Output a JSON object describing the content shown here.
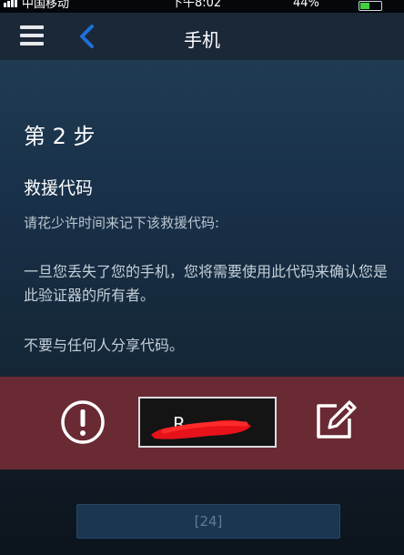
{
  "status_bar": {
    "carrier": "中国移动",
    "time": "下午8:02",
    "battery": "44%"
  },
  "nav": {
    "title": "手机",
    "menu_icon": "hamburger-menu-icon",
    "back_icon": "chevron-left-icon"
  },
  "content": {
    "step_title": "第 2 步",
    "heading": "救援代码",
    "instruction": "请花少许时间来记下该救援代码:",
    "warning_text": "一旦您丢失了您的手机，您将需要使用此代码来确认您是此验证器的所有者。",
    "share_notice": "不要与任何人分享代码。"
  },
  "code_panel": {
    "warning_icon": "exclamation-circle-icon",
    "code_visible": "R",
    "edit_icon": "pencil-square-icon"
  },
  "timer_button": {
    "label": "[24]"
  },
  "colors": {
    "accent_blue": "#1e6fd9",
    "band_red": "#6a2a33",
    "redaction": "#e8121a"
  }
}
